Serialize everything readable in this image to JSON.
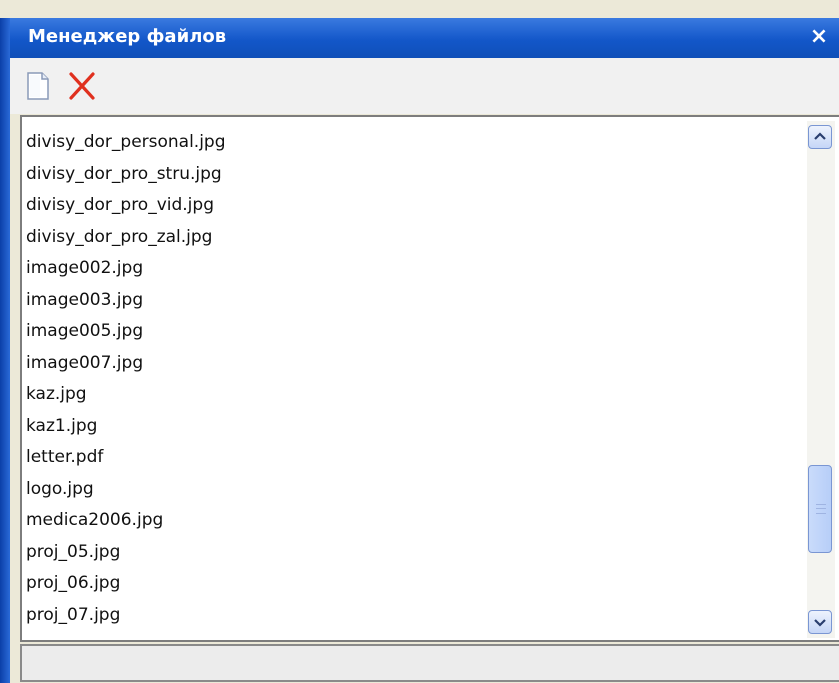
{
  "window": {
    "title": "Менеджер файлов",
    "close_label": "×"
  },
  "toolbar": {
    "buttons": [
      {
        "icon": "new-file-icon"
      },
      {
        "icon": "delete-icon",
        "color": "#e0301e"
      }
    ]
  },
  "files": [
    "divisy_dor_personal.jpg",
    "divisy_dor_pro_stru.jpg",
    "divisy_dor_pro_vid.jpg",
    "divisy_dor_pro_zal.jpg",
    "image002.jpg",
    "image003.jpg",
    "image005.jpg",
    "image007.jpg",
    "kaz.jpg",
    "kaz1.jpg",
    "letter.pdf",
    "logo.jpg",
    "medica2006.jpg",
    "proj_05.jpg",
    "proj_06.jpg",
    "proj_07.jpg"
  ],
  "scrollbar": {
    "position_fraction": 0.85
  },
  "status_bar": {
    "text": ""
  },
  "colors": {
    "titlebar": "#1357c9",
    "title_text": "#ffffff",
    "delete_icon": "#e0301e"
  }
}
